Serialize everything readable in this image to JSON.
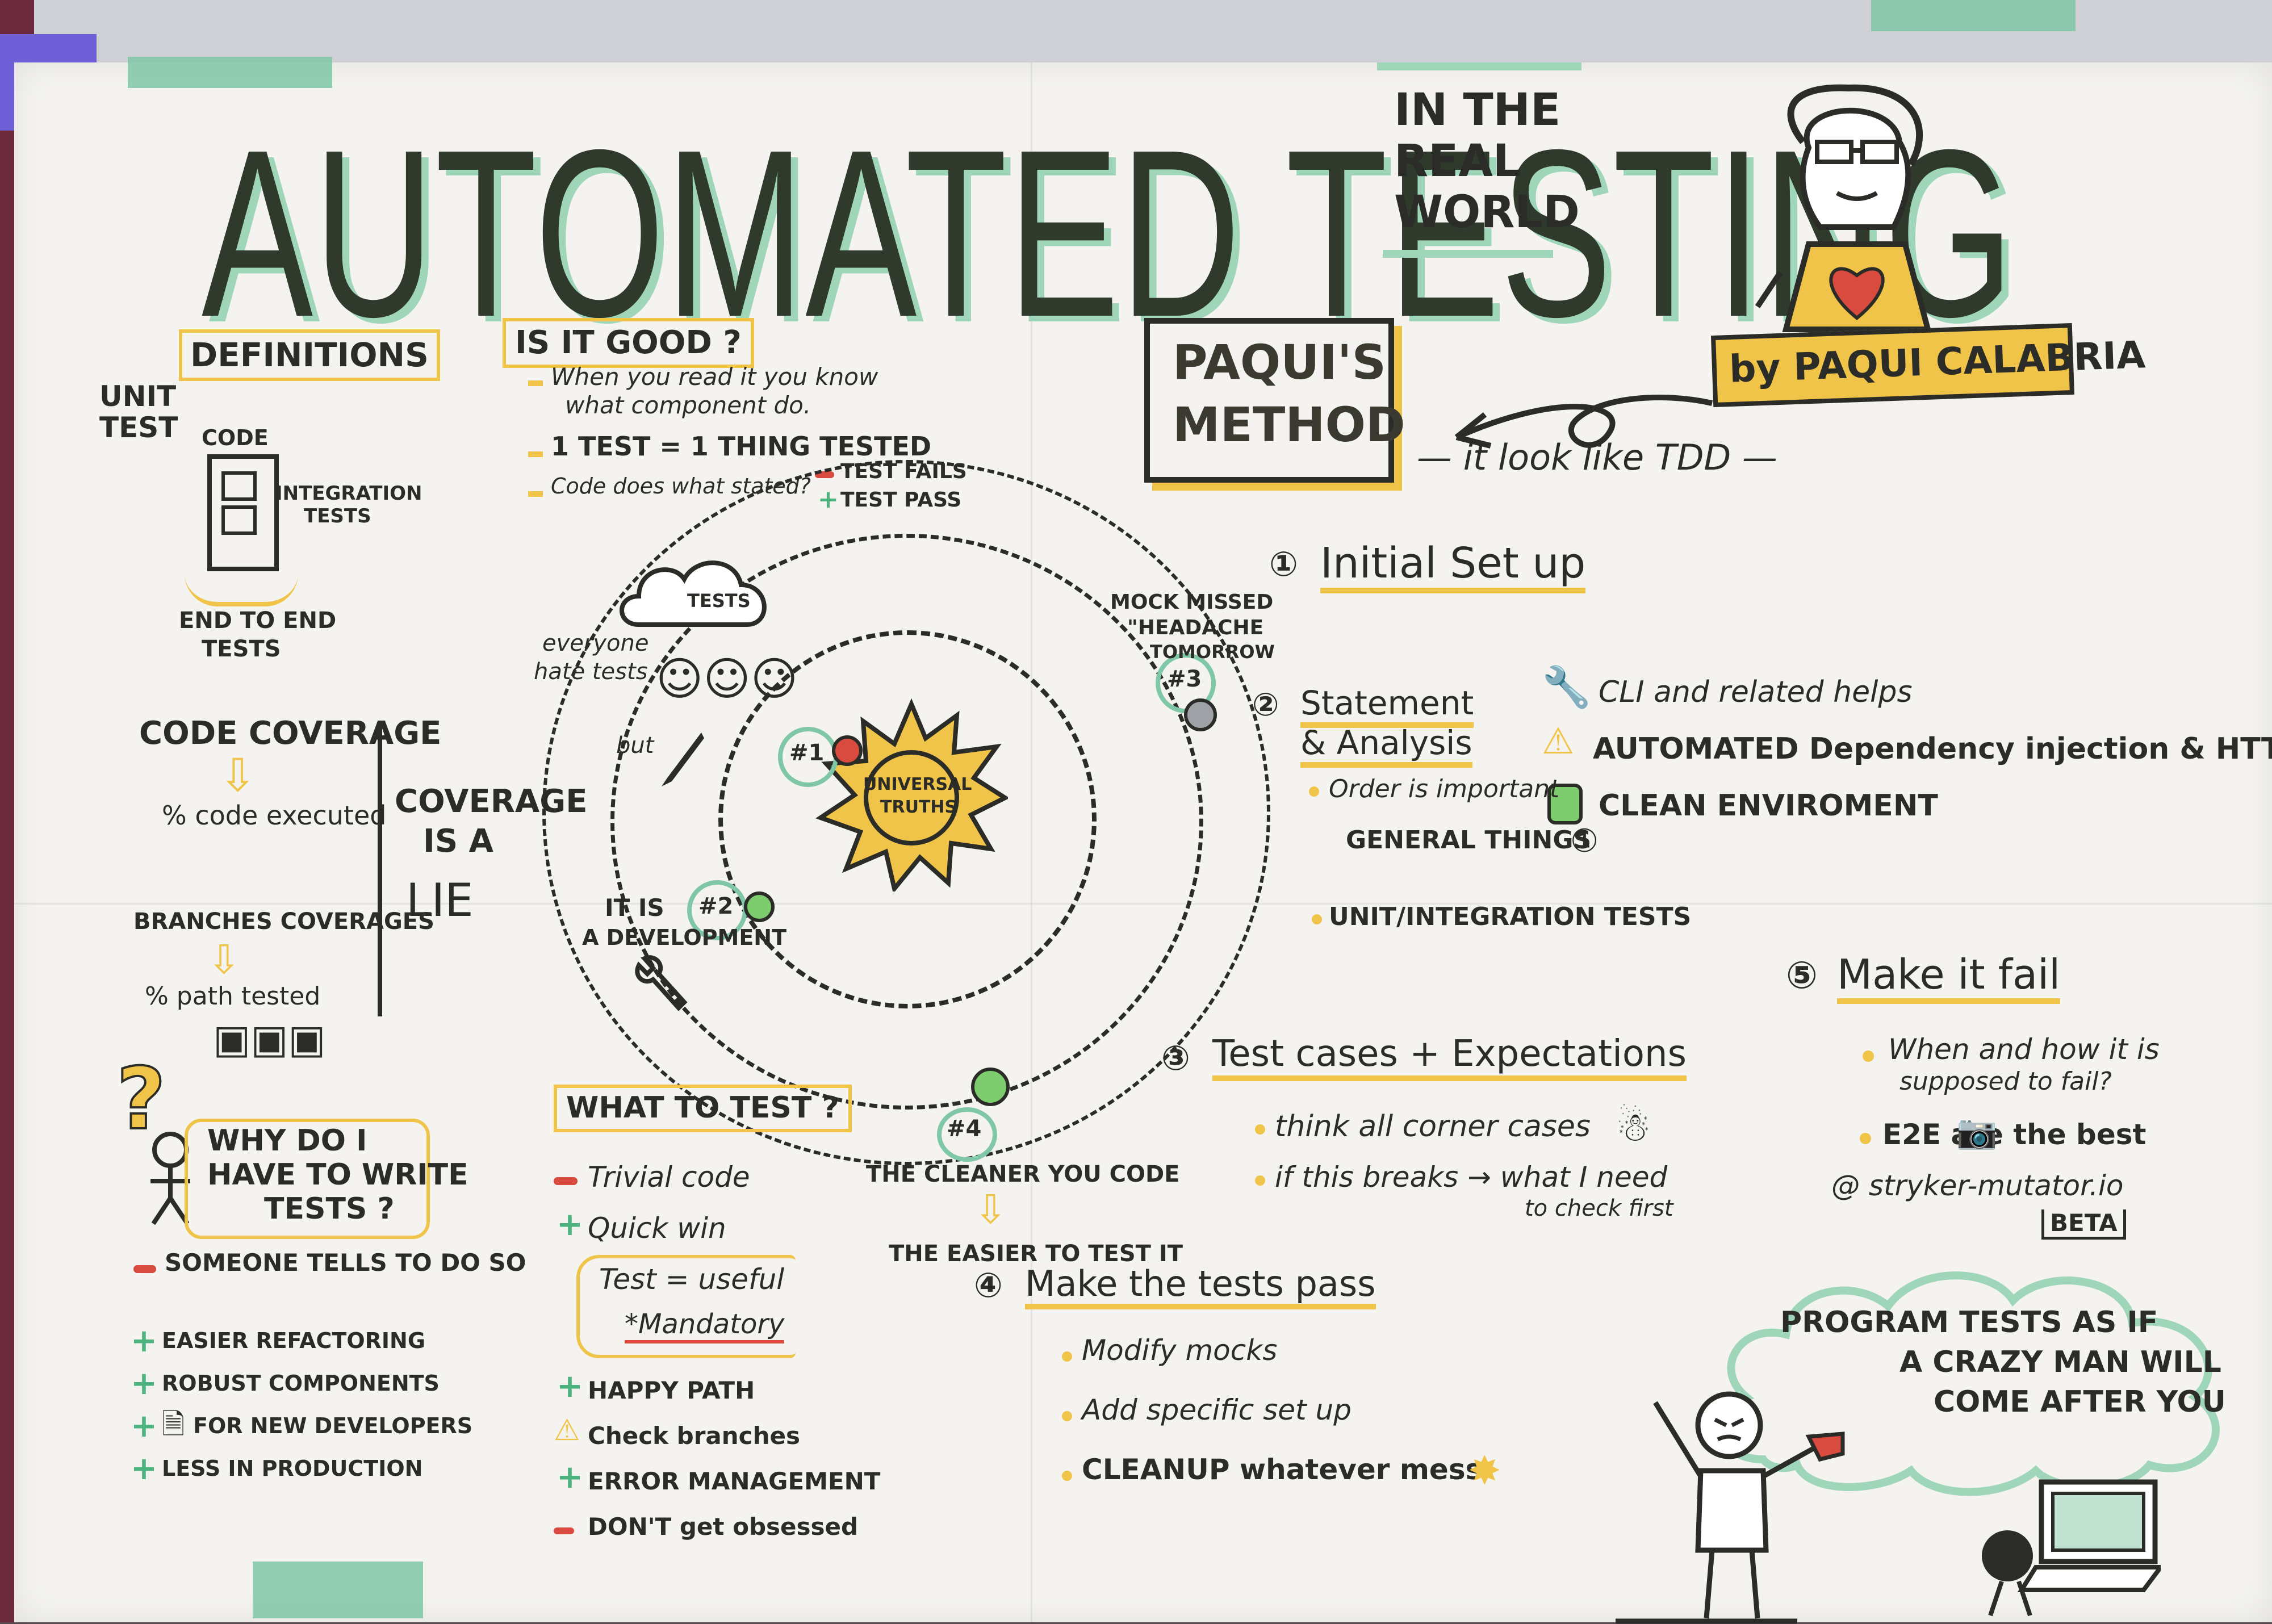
{
  "poster": {
    "title": "AUTOMATED TESTING",
    "subtitle": [
      "IN THE",
      "REAL",
      "WORLD"
    ],
    "byline": "by PAQUI CALABRIA",
    "method_box": [
      "PAQUI'S",
      "METHOD"
    ],
    "method_note": "— it look like TDD —",
    "definitions": {
      "heading": "DEFINITIONS",
      "unit": [
        "UNIT",
        "TEST"
      ],
      "code": "CODE",
      "integration": [
        "INTEGRATION",
        "TESTS"
      ],
      "e2e": [
        "END TO END",
        "TESTS"
      ],
      "code_coverage": "CODE COVERAGE",
      "code_executed": "% code executed",
      "branches": "BRANCHES COVERAGES",
      "path_tested": "% path tested",
      "coverage_lie": [
        "COVERAGE",
        "IS A",
        "LIE"
      ]
    },
    "why": {
      "question": "?",
      "heading": [
        "WHY DO I",
        "HAVE TO WRITE",
        "TESTS ?"
      ],
      "minus": "SOMEONE TELLS TO DO SO",
      "plus": [
        "EASIER REFACTORING",
        "ROBUST COMPONENTS",
        "FOR NEW DEVELOPERS",
        "LESS IN PRODUCTION"
      ]
    },
    "is_it_good": {
      "heading": "IS IT GOOD ?",
      "items": [
        "When you read it you know",
        "what component do.",
        "1 TEST = 1 THING TESTED",
        "Code does what stated?"
      ],
      "fails": "TEST FAILS",
      "pass": "TEST PASS"
    },
    "center": {
      "cloud": "TESTS",
      "everyone": [
        "everyone",
        "hate tests"
      ],
      "but": "but",
      "sun": [
        "UNIVERSAL",
        "TRUTHS"
      ],
      "n1": "#1",
      "n2": "#2",
      "n2_text": [
        "IT IS",
        "A DEVELOPMENT"
      ],
      "n3": "#3",
      "n3_text": [
        "MOCK MISSED",
        "\"HEADACHE",
        "TOMORROW"
      ],
      "n4": "#4",
      "n4_text": "THE CLEANER YOU CODE",
      "n4_result": "THE EASIER TO TEST IT"
    },
    "what_to_test": {
      "heading": "WHAT TO TEST ?",
      "minus1": "Trivial code",
      "plus1": "Quick win",
      "test_useful": "Test = useful",
      "mandatory": "*Mandatory",
      "happy": "HAPPY PATH",
      "check": "Check branches",
      "error": "ERROR MANAGEMENT",
      "obsessed": "DON'T get obsessed"
    },
    "steps": {
      "s1": "Initial Set up",
      "s1_items": [
        "CLI and related helps",
        "AUTOMATED Dependency injection & HTTP all",
        "CLEAN ENVIROMENT"
      ],
      "s2": [
        "Statement",
        "& Analysis"
      ],
      "s2_items": [
        "Order is important",
        "GENERAL THINGS",
        "UNIT/INTEGRATION TESTS"
      ],
      "s3": "Test cases + Expectations",
      "s3_items": [
        "think all corner cases",
        "if this breaks → what I need",
        "to check first"
      ],
      "s4": "Make the tests pass",
      "s4_items": [
        "Modify mocks",
        "Add specific set up",
        "CLEANUP whatever mess"
      ],
      "s5": "Make it fail",
      "s5_items": [
        "When and how it is",
        "supposed to fail?",
        "E2E are the best",
        "@ stryker-mutator.io",
        "BETA"
      ]
    },
    "cloud_quote": [
      "PROGRAM TESTS AS IF",
      "A CRAZY MAN WILL",
      "COME AFTER YOU"
    ],
    "colors": {
      "yellow": "#f0c448",
      "green": "#7fc7a6",
      "red": "#d94b3f",
      "ink": "#2b2b28",
      "paper": "#f4f3ef"
    }
  }
}
